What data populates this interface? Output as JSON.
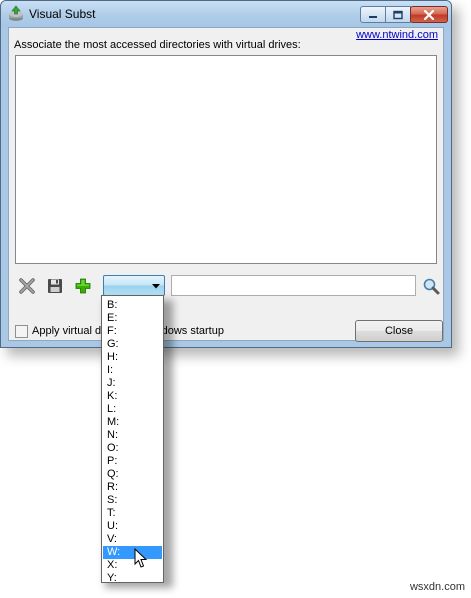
{
  "window": {
    "title": "Visual Subst",
    "description": "Associate the most accessed directories with virtual drives:",
    "website_link": "www.ntwind.com"
  },
  "toolbar": {
    "remove_icon": "remove-x-icon",
    "save_icon": "floppy-save-icon",
    "add_icon": "green-plus-icon",
    "browse_icon": "magnifier-icon",
    "selected_drive": "",
    "path_value": ""
  },
  "footer": {
    "startup_label": "Apply virtual drives on Windows startup",
    "startup_checked": false,
    "close_label": "Close"
  },
  "drive_list": [
    "B:",
    "E:",
    "F:",
    "G:",
    "H:",
    "I:",
    "J:",
    "K:",
    "L:",
    "M:",
    "N:",
    "O:",
    "P:",
    "Q:",
    "R:",
    "S:",
    "T:",
    "U:",
    "V:",
    "W:",
    "X:",
    "Y:"
  ],
  "highlighted_drive": "W:",
  "watermark": "wsxdn.com",
  "colors": {
    "selection": "#3399ff",
    "link": "#0000cc",
    "titlebar": "#afcde9"
  }
}
